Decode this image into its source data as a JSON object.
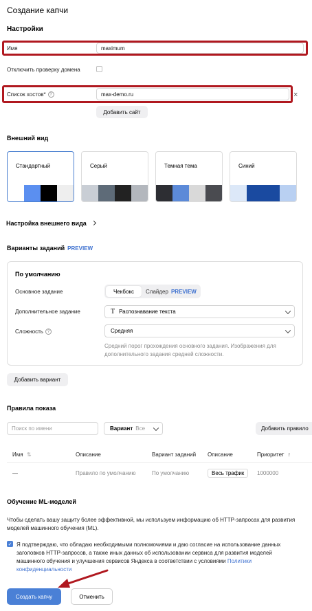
{
  "page": {
    "title": "Создание капчи"
  },
  "settings": {
    "heading": "Настройки",
    "name_label": "Имя",
    "name_value": "maximum",
    "disable_domain_check_label": "Отключить проверку домена",
    "hosts_label": "Список хостов*",
    "hosts_value": "max-demo.ru",
    "add_site_label": "Добавить сайт"
  },
  "appearance": {
    "heading": "Внешний вид",
    "themes": [
      {
        "name": "Стандартный",
        "swatches": [
          "#ffffff",
          "#5b8ff0",
          "#000000",
          "#eeeeee"
        ],
        "selected": true
      },
      {
        "name": "Серый",
        "swatches": [
          "#c9ced5",
          "#5e6b78",
          "#222222",
          "#b3b7bd"
        ],
        "selected": false
      },
      {
        "name": "Темная тема",
        "swatches": [
          "#2d2e33",
          "#5c8ad8",
          "#d9d9d9",
          "#4a4b50"
        ],
        "selected": false
      },
      {
        "name": "Синий",
        "swatches": [
          "#dce8f8",
          "#1a4aa0",
          "#1a4aa0",
          "#b9d0f2"
        ],
        "selected": false
      }
    ],
    "settings_link": "Настройка внешнего вида"
  },
  "task_variants": {
    "heading": "Варианты заданий",
    "preview_badge": "PREVIEW",
    "default_card_title": "По умолчанию",
    "main_task_label": "Основное задание",
    "main_task_options": [
      "Чекбокс",
      "Слайдер"
    ],
    "slider_preview": "PREVIEW",
    "extra_task_label": "Дополнительное задание",
    "extra_task_value": "Распознавание текста",
    "difficulty_label": "Сложность",
    "difficulty_value": "Средняя",
    "difficulty_hint": "Средний порог прохождения основного задания. Изображения для дополнительного задания средней сложности.",
    "add_variant_label": "Добавить вариант"
  },
  "display_rules": {
    "heading": "Правила показа",
    "search_placeholder": "Поиск по имени",
    "variant_filter_label": "Вариант",
    "variant_filter_value": "Все",
    "add_rule_label": "Добавить правило",
    "columns": [
      "Имя",
      "Описание",
      "Вариант заданий",
      "Описание",
      "Приоритет"
    ],
    "row": {
      "name": "—",
      "description": "Правило по умолчанию",
      "variant": "По умолчанию",
      "badge": "Весь трафик",
      "priority": "1000000"
    }
  },
  "ml": {
    "heading": "Обучение ML-моделей",
    "description": "Чтобы сделать вашу защиту более эффективной, мы используем информацию об HTTP-запросах для развития моделей машинного обучения (ML).",
    "consent_text": "Я подтверждаю, что обладаю необходимыми полномочиями и даю согласие на использование данных заголовков HTTP-запросов, а также иных данных об использовании сервиса для развития моделей машинного обучения и улучшения сервисов Яндекса в соответствии с условиями",
    "consent_link": "Политики конфиденциальности",
    "consent_checked": true
  },
  "actions": {
    "create_label": "Создать капчу",
    "cancel_label": "Отменить"
  },
  "colors": {
    "accent": "#4a80d6",
    "highlight": "#b0181f"
  }
}
